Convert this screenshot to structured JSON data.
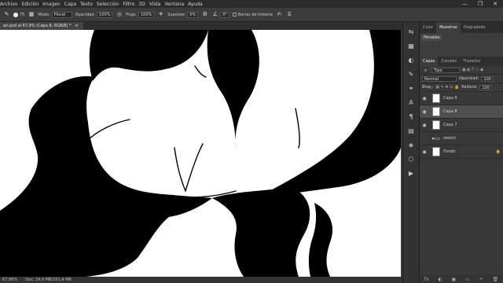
{
  "menu": [
    "Archivo",
    "Edición",
    "Imagen",
    "Capa",
    "Texto",
    "Selección",
    "Filtro",
    "3D",
    "Vista",
    "Ventana",
    "Ayuda"
  ],
  "options": {
    "brush_size": "75",
    "mode_label": "Modo:",
    "mode_value": "Pincel",
    "opacity_label": "Opacidad:",
    "opacity_value": "100%",
    "flow_label": "Flujo:",
    "flow_value": "100%",
    "smoothing_label": "Suavizar:",
    "smoothing_value": "0%",
    "angle_value": "0°",
    "history_label": "Borrar de historia"
  },
  "document": {
    "tab_title": "ari.psd al 67,9% (Capa 8, RGB/8) *",
    "close": "×"
  },
  "status": {
    "zoom": "67,86%",
    "doc": "Doc: 24,9 MB/201,4 MB"
  },
  "panels": {
    "top_tabs": [
      "Color",
      "Muestras",
      "Degradado"
    ],
    "brush_tab": "Pinceles",
    "layer_tabs": [
      "Capas",
      "Canales",
      "Trazados"
    ],
    "filter_kind": "Tipo",
    "blend_mode": "Normal",
    "opacity_label": "Opacidad:",
    "opacity_value": "100",
    "lock_label": "Bloq.:",
    "fill_label": "Relleno:",
    "fill_value": "100",
    "layers": [
      {
        "name": "Capa 9"
      },
      {
        "name": "Capa 8"
      },
      {
        "name": "Capa 7"
      },
      {
        "name": "sketch"
      },
      {
        "name": "Fondo"
      }
    ],
    "footer": [
      "fx",
      "◐",
      "▣",
      "▭",
      "+",
      "🗑"
    ]
  },
  "colors": {
    "accent": "#4a4a4a",
    "canvas": "#ffffff",
    "ink": "#000000"
  }
}
